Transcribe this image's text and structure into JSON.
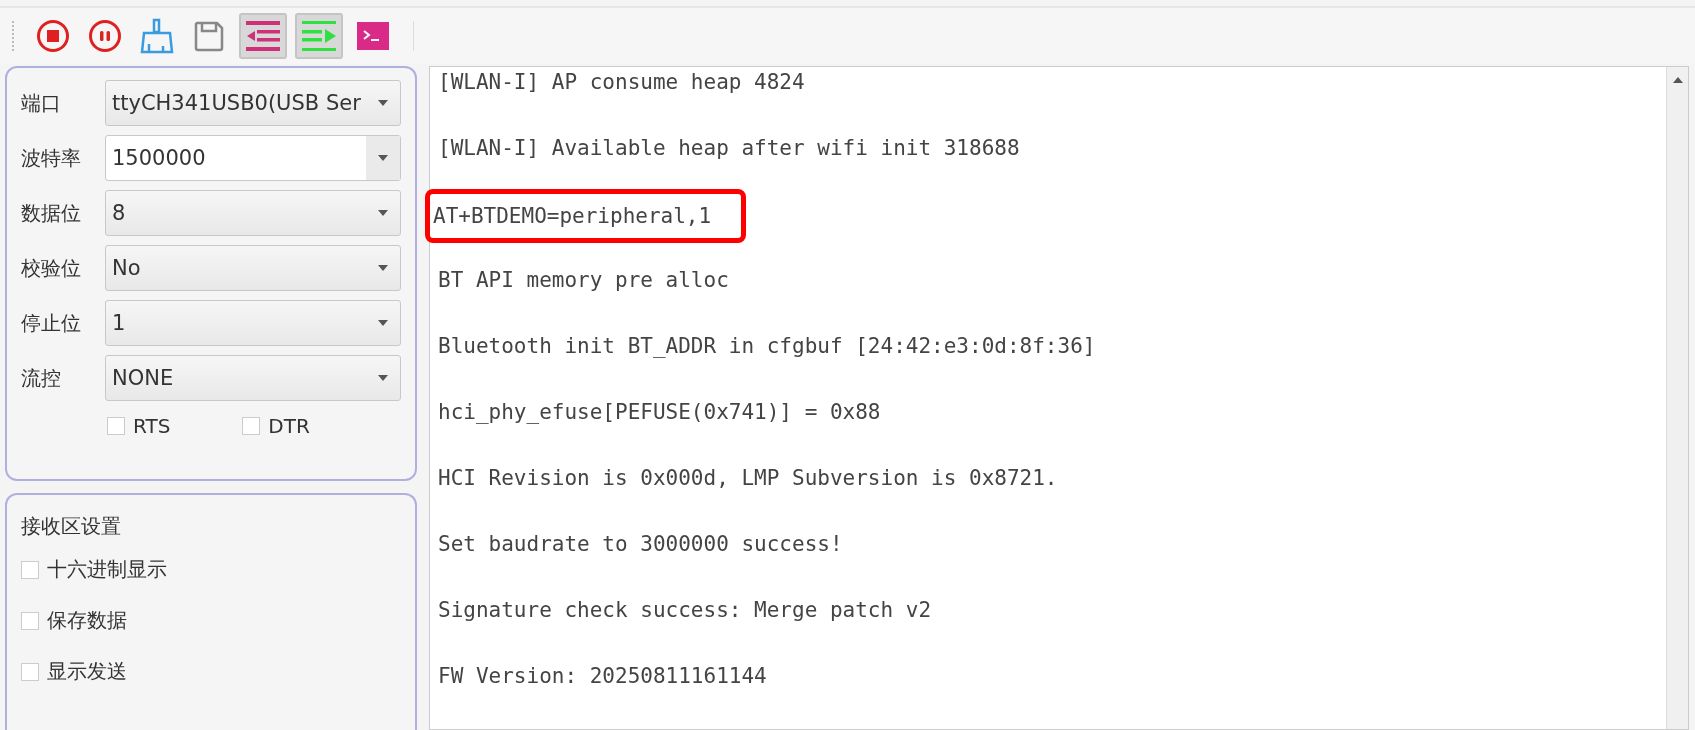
{
  "toolbar": {
    "buttons": [
      {
        "kind": "stop",
        "pressed": false
      },
      {
        "kind": "pause",
        "pressed": false
      },
      {
        "kind": "clear",
        "pressed": false
      },
      {
        "kind": "save",
        "pressed": false
      },
      {
        "kind": "receive",
        "pressed": true
      },
      {
        "kind": "send",
        "pressed": true
      },
      {
        "kind": "terminal",
        "pressed": false
      }
    ]
  },
  "serial_settings": {
    "fields": [
      {
        "label": "端口",
        "value": "ttyCH341USB0(USB Ser",
        "kind": "combo"
      },
      {
        "label": "波特率",
        "value": "1500000",
        "kind": "editable"
      },
      {
        "label": "数据位",
        "value": "8",
        "kind": "combo"
      },
      {
        "label": "校验位",
        "value": "No",
        "kind": "combo"
      },
      {
        "label": "停止位",
        "value": "1",
        "kind": "combo"
      },
      {
        "label": "流控",
        "value": "NONE",
        "kind": "combo"
      }
    ],
    "flags": [
      {
        "label": "RTS",
        "checked": false
      },
      {
        "label": "DTR",
        "checked": false
      }
    ]
  },
  "receive_settings": {
    "title": "接收区设置",
    "options": [
      {
        "label": "十六进制显示",
        "checked": false
      },
      {
        "label": "保存数据",
        "checked": false
      },
      {
        "label": "显示发送",
        "checked": false
      }
    ]
  },
  "log": {
    "lines": [
      {
        "text": "[WLAN-I] AP consume heap 4824",
        "highlighted": false
      },
      {
        "text": "[WLAN-I] Available heap after wifi init 318688",
        "highlighted": false
      },
      {
        "text": "AT+BTDEMO=peripheral,1",
        "highlighted": true
      },
      {
        "text": "BT API memory pre alloc",
        "highlighted": false
      },
      {
        "text": "Bluetooth init BT_ADDR in cfgbuf [24:42:e3:0d:8f:36]",
        "highlighted": false
      },
      {
        "text": "hci_phy_efuse[PEFUSE(0x741)] = 0x88",
        "highlighted": false
      },
      {
        "text": "HCI Revision is 0x000d, LMP Subversion is 0x8721.",
        "highlighted": false
      },
      {
        "text": "Set baudrate to 3000000 success!",
        "highlighted": false
      },
      {
        "text": "Signature check success: Merge patch v2",
        "highlighted": false
      },
      {
        "text": "FW Version: 20250811161144",
        "highlighted": false
      }
    ]
  }
}
